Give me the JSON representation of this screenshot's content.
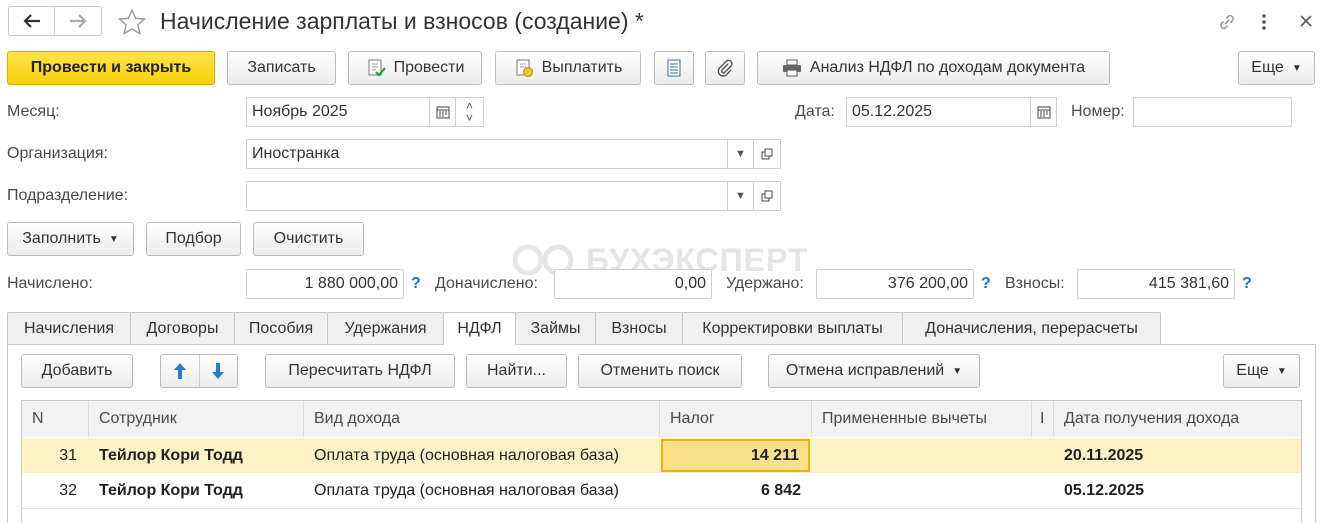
{
  "window": {
    "title": "Начисление зарплаты и взносов (создание) *",
    "back_icon": "arrow-left",
    "forward_icon": "arrow-right",
    "star_icon": "star-outline",
    "link_icon": "chain-link",
    "more_icon": "vertical-dots",
    "close_icon": "x"
  },
  "toolbar": {
    "post_close": "Провести и закрыть",
    "save": "Записать",
    "post": "Провести",
    "pay": "Выплатить",
    "ndfl_analysis": "Анализ НДФЛ по доходам документа",
    "more": "Еще"
  },
  "form": {
    "month_label": "Месяц:",
    "month_value": "Ноябрь 2025",
    "date_label": "Дата:",
    "date_value": "05.12.2025",
    "number_label": "Номер:",
    "number_value": "",
    "org_label": "Организация:",
    "org_value": "Иностранка",
    "dept_label": "Подразделение:",
    "dept_value": ""
  },
  "actions": {
    "fill": "Заполнить",
    "select": "Подбор",
    "clear": "Очистить"
  },
  "watermark": "БУХЭКСПЕРТ",
  "totals": {
    "accrued_label": "Начислено:",
    "accrued_value": "1 880 000,00",
    "additional_label": "Доначислено:",
    "additional_value": "0,00",
    "withheld_label": "Удержано:",
    "withheld_value": "376 200,00",
    "contrib_label": "Взносы:",
    "contrib_value": "415 381,60",
    "help": "?"
  },
  "tabs": [
    "Начисления",
    "Договоры",
    "Пособия",
    "Удержания",
    "НДФЛ",
    "Займы",
    "Взносы",
    "Корректировки выплаты",
    "Доначисления, перерасчеты"
  ],
  "active_tab": "НДФЛ",
  "table_toolbar": {
    "add": "Добавить",
    "recalc": "Пересчитать НДФЛ",
    "find": "Найти...",
    "cancel_search": "Отменить поиск",
    "cancel_fix": "Отмена исправлений",
    "more": "Еще"
  },
  "table": {
    "headers": {
      "n": "N",
      "employee": "Сотрудник",
      "income_type": "Вид дохода",
      "tax": "Налог",
      "deductions": "Примененные вычеты",
      "narrow": "I",
      "income_date": "Дата получения дохода"
    },
    "rows": [
      {
        "n": "31",
        "employee": "Тейлор Кори Тодд",
        "income_type": "Оплата труда (основная налоговая база)",
        "tax": "14 211",
        "deductions": "",
        "income_date": "20.11.2025"
      },
      {
        "n": "32",
        "employee": "Тейлор Кори Тодд",
        "income_type": "Оплата труда (основная налоговая база)",
        "tax": "6 842",
        "deductions": "",
        "income_date": "05.12.2025"
      }
    ]
  },
  "colors": {
    "primary_button": "#f8d10d",
    "selected_row": "#fdf2c6",
    "selected_cell_border": "#e6b800",
    "help_blue": "#1d73c8"
  }
}
